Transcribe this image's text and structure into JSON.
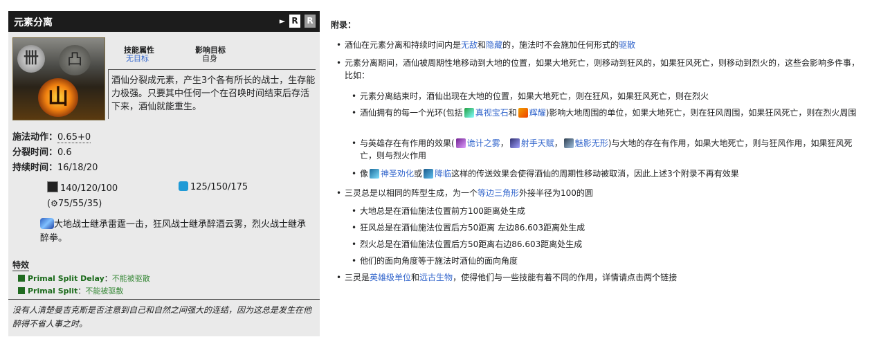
{
  "ability": {
    "title": "元素分离",
    "play": "►",
    "r_button": "R",
    "r_button_alt": "R",
    "attr_label": "技能属性",
    "attr_value": "无目标",
    "target_label": "影响目标",
    "target_value": "自身",
    "description": "酒仙分裂成元素，产生3个各有所长的战士，生存能力极强。只要其中任何一个在召唤时间结束后存活下来，酒仙就能重生。",
    "cast_label": "施法动作：",
    "cast_value": "0.65+0",
    "split_label": "分裂时间：",
    "split_value": "0.6",
    "duration_label": "持续时间：",
    "duration_value": "16/18/20",
    "cooldown": "140/120/100",
    "mana": "125/150/175",
    "cooldown_alt": "(",
    "cooldown_alt_value": "75/55/35)",
    "scepter_text": "大地战士继承雷霆一击，狂风战士继承醉酒云雾，烈火战士继承醉拳。",
    "effects_title": "特效",
    "effects": [
      {
        "name": "Primal Split Delay",
        "sep": "：",
        "value": "不能被驱散"
      },
      {
        "name": "Primal Split",
        "sep": "：",
        "value": "不能被驱散"
      }
    ],
    "lore": "没有人清楚曼吉克斯是否注意到自己和自然之间强大的连结，因为这总是发生在他醉得不省人事之时。",
    "icons": {
      "storm": "卌",
      "earth": "凸",
      "fire": "山"
    }
  },
  "notes": {
    "title": "附录：",
    "b1": {
      "a": "酒仙在元素分离和持续时间内是",
      "l1": "无敌",
      "b": "和",
      "l2": "隐藏",
      "c": "的，施法时不会施加任何形式的",
      "l3": "驱散"
    },
    "b2": "元素分离期间，酒仙被周期性地移动到大地的位置，如果大地死亡，则移动到狂风的，如果狂风死亡，则移动到烈火的，这些会影响多件事，比如：",
    "b2_1": "元素分离结束时，酒仙出现在大地的位置，如果大地死亡，则在狂风，如果狂风死亡，则在烈火",
    "b2_2": {
      "a": "酒仙拥有的每一个光环(包括",
      "l1": "真视宝石",
      "b": "和",
      "l2": "辉耀",
      "c": ")影响大地周围的单位，如果大地死亡，则在狂风周围，如果狂风死亡，则在烈火周围"
    },
    "b2_3": {
      "a": "与英雄存在有作用的效果(",
      "l1": "诡计之雾",
      "b": "，",
      "l2": "射手天赋",
      "c": "，",
      "l3": "魅影无形",
      "d": ")与大地的存在有作用，如果大地死亡，则与狂风作用，如果狂风死亡，则与烈火作用"
    },
    "b2_4": {
      "a": "像",
      "l1": "神圣劝化",
      "b": "或",
      "l2": "降临",
      "c": "这样的传送效果会使得酒仙的周期性移动被取消，因此上述3个附录不再有效果"
    },
    "b3": {
      "a": "三灵总是以相同的阵型生成，为一个",
      "l1": "等边三角形",
      "b": "外接半径为100的圆"
    },
    "b3_1": "大地总是在酒仙施法位置前方100距离处生成",
    "b3_2": "狂风总是在酒仙施法位置后方50距离 左边86.603距离处生成",
    "b3_3": "烈火总是在酒仙施法位置后方50距离右边86.603距离处生成",
    "b3_4": "他们的面向角度等于施法时酒仙的面向角度",
    "b4": {
      "a": "三灵是",
      "l1": "英雄级单位",
      "b": "和",
      "l2": "远古生物",
      "c": "，使得他们与一些技能有着不同的作用，详情请点击两个链接"
    }
  }
}
